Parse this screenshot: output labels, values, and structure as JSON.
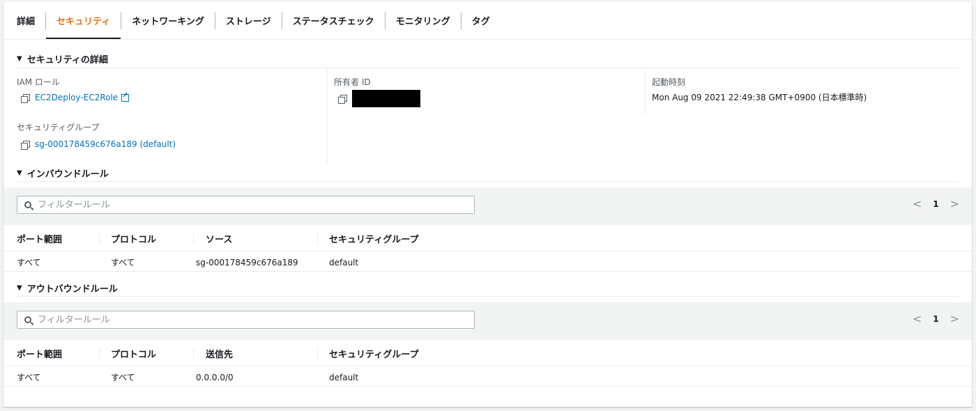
{
  "tabs": [
    "詳細",
    "セキュリティ",
    "ネットワーキング",
    "ストレージ",
    "ステータスチェック",
    "モニタリング",
    "タグ"
  ],
  "active_tab": 1,
  "security_details": {
    "heading": "セキュリティの詳細",
    "iam_role_label": "IAM ロール",
    "iam_role_value": "EC2Deploy-EC2Role",
    "owner_id_label": "所有者 ID",
    "launch_time_label": "起動時刻",
    "launch_time_value": "Mon Aug 09 2021 22:49:38 GMT+0900 (日本標準時)",
    "security_group_label": "セキュリティグループ",
    "security_group_value": "sg-000178459c676a189 (default)"
  },
  "inbound": {
    "heading": "インバウンドルール",
    "filter_placeholder": "フィルタールール",
    "page": "1",
    "columns": [
      "ポート範囲",
      "プロトコル",
      "ソース",
      "セキュリティグループ"
    ],
    "rows": [
      [
        "すべて",
        "すべて",
        "sg-000178459c676a189",
        "default"
      ]
    ]
  },
  "outbound": {
    "heading": "アウトバウンドルール",
    "filter_placeholder": "フィルタールール",
    "page": "1",
    "columns": [
      "ポート範囲",
      "プロトコル",
      "送信先",
      "セキュリティグループ"
    ],
    "rows": [
      [
        "すべて",
        "すべて",
        "0.0.0.0/0",
        "default"
      ]
    ]
  },
  "colors": {
    "accent": "#ec7211",
    "link": "#0073bb"
  },
  "icons": [
    "caret-down-icon",
    "copy-icon",
    "external-link-icon",
    "search-icon",
    "chevron-left-icon",
    "chevron-right-icon"
  ]
}
